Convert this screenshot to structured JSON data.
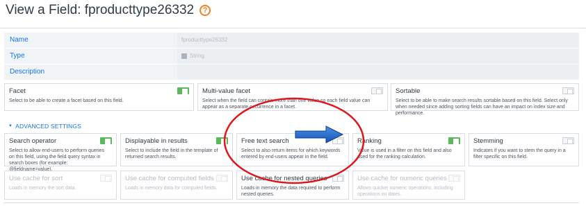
{
  "page": {
    "title": "View a Field: fproducttype26332",
    "help_icon": "question-circle-icon"
  },
  "properties": [
    {
      "label": "Name",
      "value": "fproducttype26332"
    },
    {
      "label": "Type",
      "value": "String"
    },
    {
      "label": "Description",
      "value": ""
    }
  ],
  "top_options": [
    {
      "title": "Facet",
      "desc": "Select to be able to create a facet based on this field.",
      "enabled": true
    },
    {
      "title": "Multi-value facet",
      "desc": "Select when the field can contain more than one value so each field value can appear as a separate occurrence in a facet.",
      "enabled": false
    },
    {
      "title": "Sortable",
      "desc": "Select to be able to make search results sortable based on this field. Select only when needed since adding sorting fields can have an impact on index size and performance.",
      "enabled": false
    }
  ],
  "advanced": {
    "header": "ADVANCED SETTINGS",
    "row1": [
      {
        "title": "Search operator",
        "desc": "Select to allow end-users to perform queries on this field, using the field query syntax in search boxes (for example: @fieldname=value).",
        "enabled": true
      },
      {
        "title": "Displayable in results",
        "desc": "Select to include the field in the template of returned search results.",
        "enabled": true
      },
      {
        "title": "Free text search",
        "desc": "Select to also return items for which keywords entered by end-users appear in the field.",
        "enabled": false
      },
      {
        "title": "Ranking",
        "desc": "Value is used in a filter on this field and also used for the ranking calculation.",
        "enabled": true
      },
      {
        "title": "Stemming",
        "desc": "Indicates if you want to stem the query in a filter specific on this field.",
        "enabled": false
      }
    ],
    "row2": [
      {
        "title": "Use cache for sort",
        "desc": "Loads in memory the sort data.",
        "enabled": false
      },
      {
        "title": "Use cache for computed fields",
        "desc": "Loads in memory data for computed fields.",
        "enabled": false
      },
      {
        "title": "Use cache for nested queries",
        "desc": "Loads in memory the data required to perform nested queries.",
        "enabled": false
      },
      {
        "title": "Use cache for numeric queries",
        "desc": "Allows quicker numeric operations, including operations on dates.",
        "enabled": false
      }
    ]
  },
  "colors": {
    "accent": "#1372ec",
    "toggle_on": "#5cb85c",
    "help": "#f58020",
    "annotation_circle": "#e0161b",
    "annotation_arrow": "#1f6fd6"
  }
}
